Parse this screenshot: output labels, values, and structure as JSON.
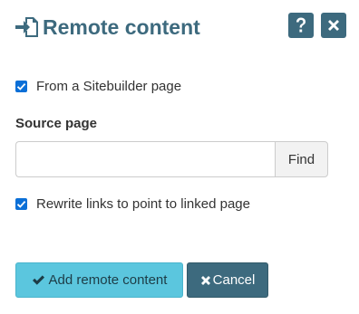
{
  "dialog": {
    "title": "Remote content",
    "title_icon": "file-import-icon",
    "help_icon": "question-icon",
    "close_icon": "close-icon",
    "accent_color": "#3d6a7e"
  },
  "options": {
    "from_sitebuilder": {
      "label": "From a Sitebuilder page",
      "checked": true
    },
    "rewrite_links": {
      "label": "Rewrite links to point to linked page",
      "checked": true
    }
  },
  "source": {
    "label": "Source page",
    "value": "",
    "find_label": "Find"
  },
  "footer": {
    "add_label": "Add remote content",
    "add_icon": "check-icon",
    "add_color": "#5bc6de",
    "cancel_label": "Cancel",
    "cancel_icon": "times-icon"
  }
}
